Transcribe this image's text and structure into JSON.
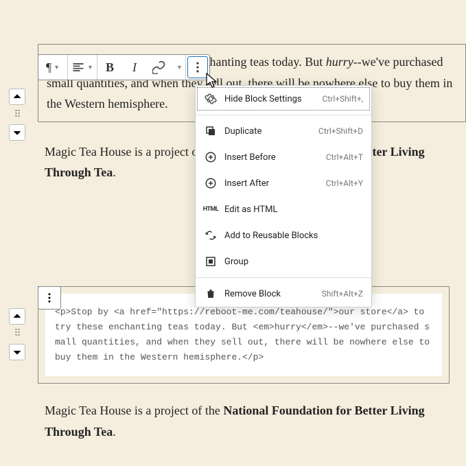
{
  "toolbar": {
    "paragraph_symbol": "¶",
    "bold": "B",
    "italic": "I"
  },
  "paragraph1": {
    "prefix": "Stop by ",
    "link_text": "our store",
    "mid1": " to try these enchanting teas today. But ",
    "em": "hurry",
    "rest": "--we've purchased small quantities, and when they sell out, there will be nowhere else to buy them in the Western hemisphere."
  },
  "paragraph2": {
    "prefix": "Magic Tea House is a project of the ",
    "bold": "National Foundation for Better Living Through Tea",
    "suffix": "."
  },
  "menu": {
    "hide": "Hide Block Settings",
    "hide_sc": "Ctrl+Shift+,",
    "duplicate": "Duplicate",
    "duplicate_sc": "Ctrl+Shift+D",
    "insert_before": "Insert Before",
    "insert_before_sc": "Ctrl+Alt+T",
    "insert_after": "Insert After",
    "insert_after_sc": "Ctrl+Alt+Y",
    "edit_html": "Edit as HTML",
    "reusable": "Add to Reusable Blocks",
    "group": "Group",
    "remove": "Remove Block",
    "remove_sc": "Shift+Alt+Z"
  },
  "html_code": "<p>Stop by <a href=\"https://reboot-me.com/teahouse/\">our store</a> to try these enchanting teas today. But <em>hurry</em>--we've purchased small quantities, and when they sell out, there will be nowhere else to buy them in the Western hemisphere.</p>"
}
